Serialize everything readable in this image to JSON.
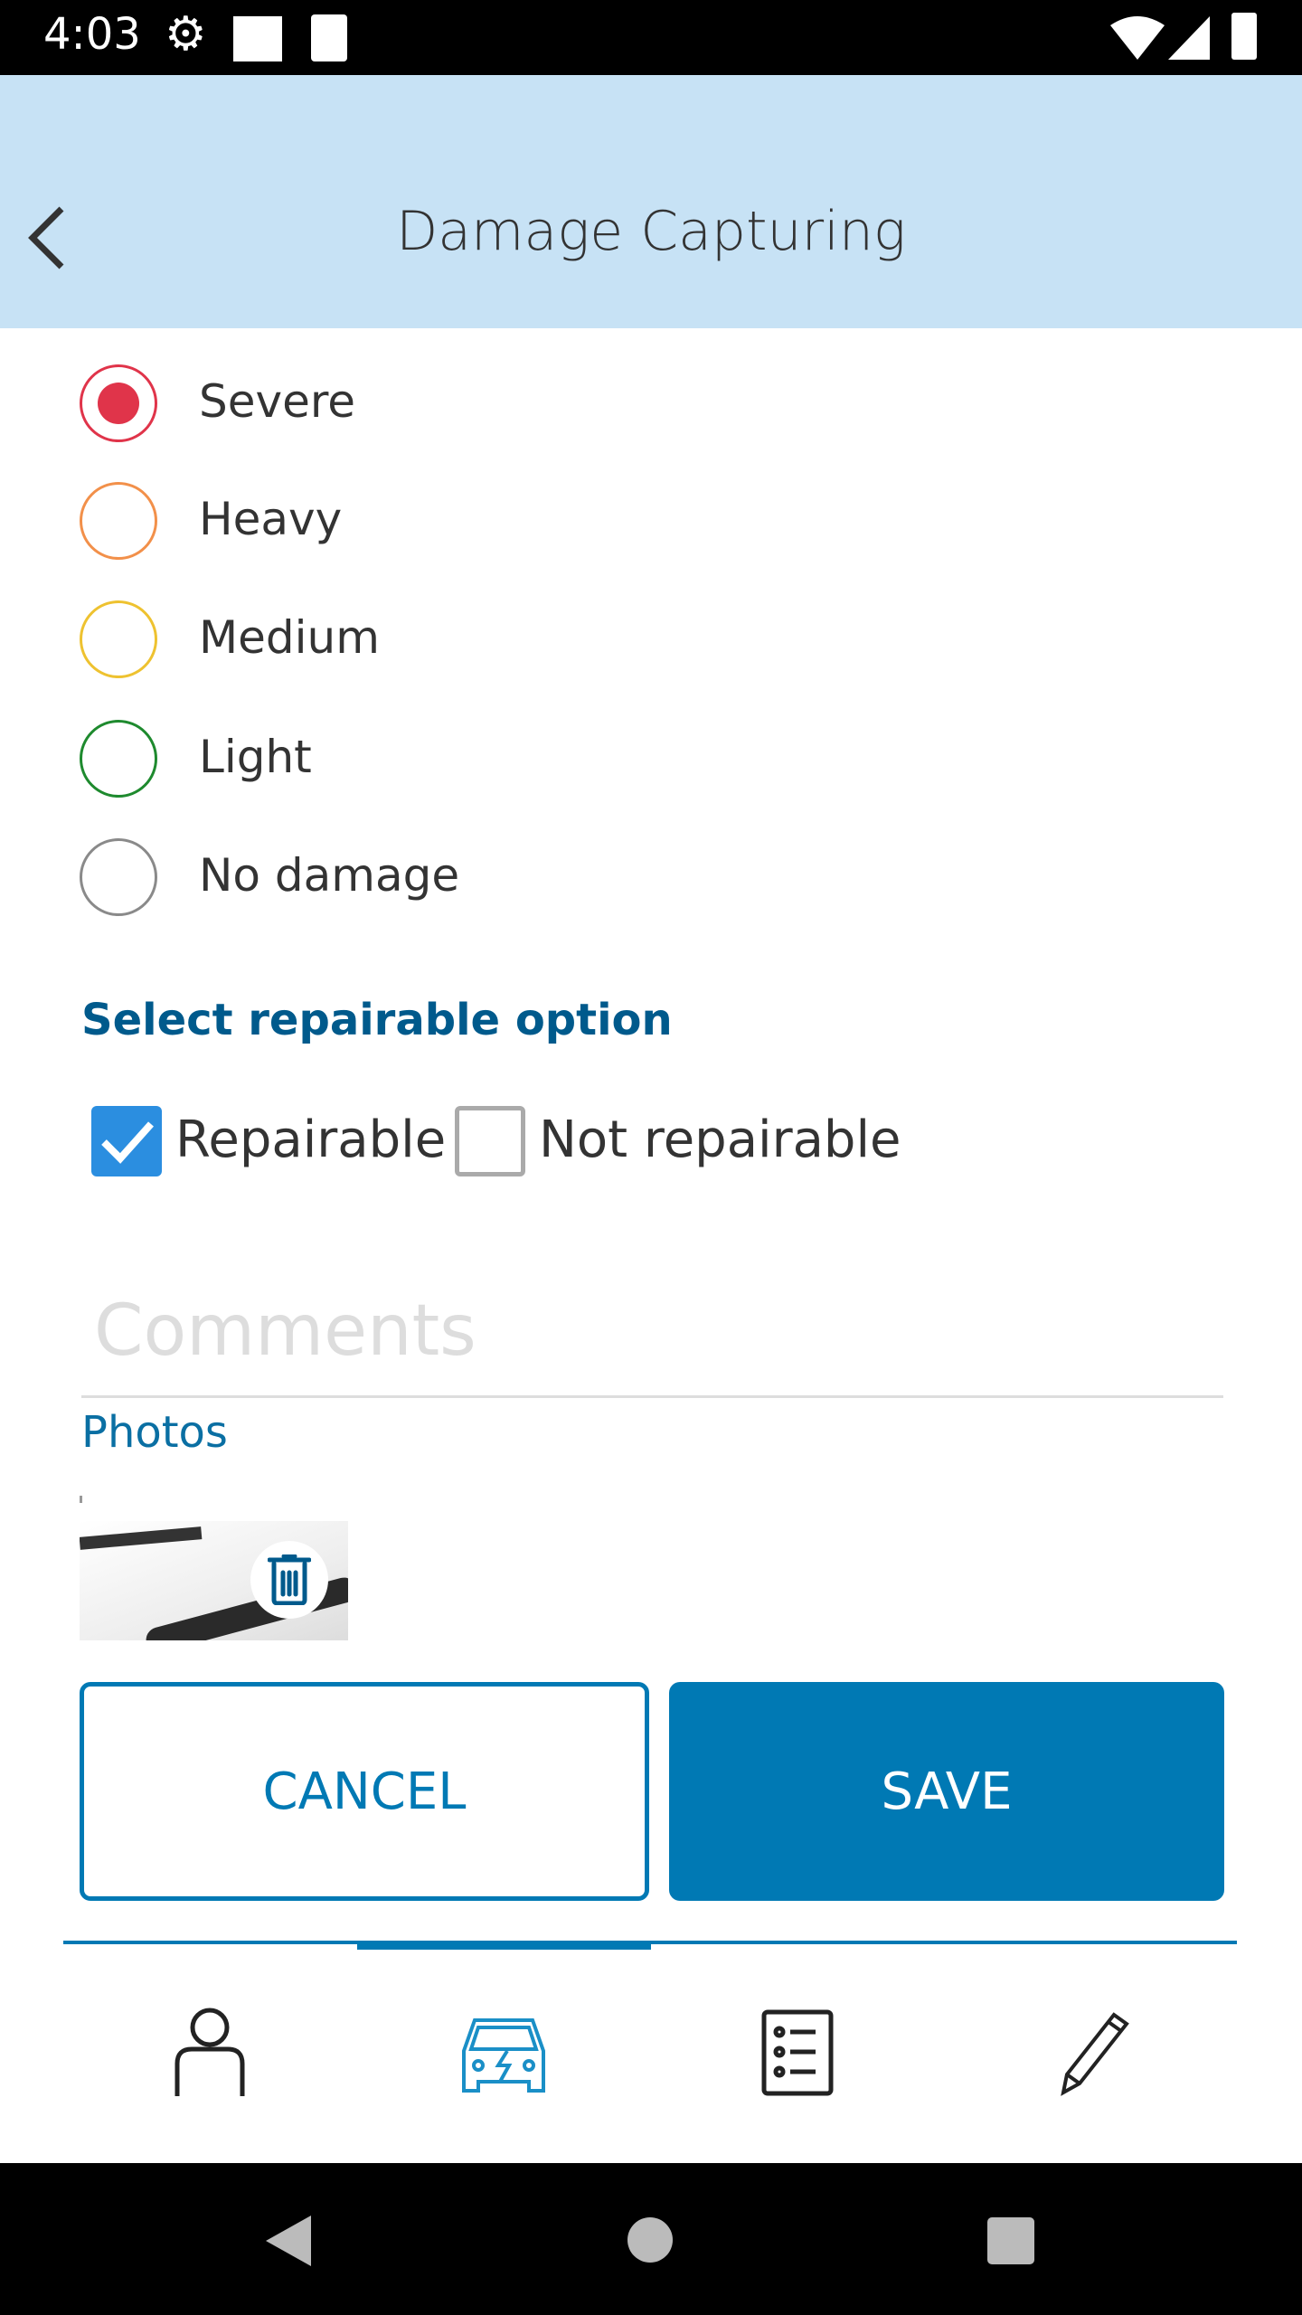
{
  "status_bar": {
    "time": "4:03",
    "icons": [
      "settings-icon",
      "sim-icon",
      "sd-card-icon",
      "wifi-icon",
      "signal-icon",
      "battery-icon"
    ]
  },
  "header": {
    "title": "Damage Capturing",
    "back_icon": "chevron-left-icon"
  },
  "severity": {
    "selected": "Severe",
    "options": [
      {
        "label": "Severe",
        "color": "#e0344a"
      },
      {
        "label": "Heavy",
        "color": "#f2904a"
      },
      {
        "label": "Medium",
        "color": "#eec230"
      },
      {
        "label": "Light",
        "color": "#1e8a2e"
      },
      {
        "label": "No damage",
        "color": "#8a8a8a"
      }
    ]
  },
  "repairable": {
    "heading": "Select repairable option",
    "options": [
      {
        "label": "Repairable",
        "checked": true
      },
      {
        "label": "Not repairable",
        "checked": false
      }
    ]
  },
  "comments": {
    "placeholder": "Comments",
    "value": ""
  },
  "photos": {
    "label": "Photos",
    "delete_icon": "trash-icon"
  },
  "buttons": {
    "cancel": "CANCEL",
    "save": "SAVE"
  },
  "colors": {
    "accent": "#0079b4",
    "header_bg": "#c7e2f5",
    "heading": "#005a8c"
  },
  "bottom_nav": {
    "active_index": 1,
    "items": [
      "person-icon",
      "car-damage-icon",
      "checklist-icon",
      "pen-icon"
    ]
  },
  "system_nav": [
    "back-icon",
    "home-icon",
    "recents-icon"
  ]
}
